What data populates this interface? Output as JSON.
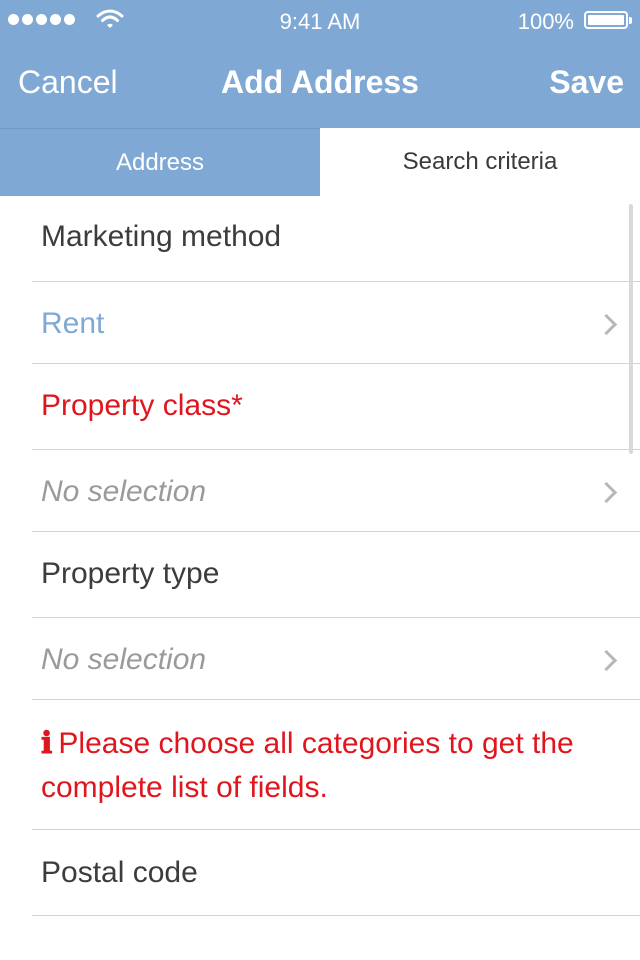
{
  "status_bar": {
    "time": "9:41 AM",
    "battery": "100%"
  },
  "nav": {
    "cancel": "Cancel",
    "title": "Add Address",
    "save": "Save"
  },
  "tabs": [
    {
      "label": "Address",
      "selected": false
    },
    {
      "label": "Search criteria",
      "selected": true
    }
  ],
  "form": {
    "marketing_method": {
      "label": "Marketing method",
      "value": "Rent"
    },
    "property_class": {
      "label": "Property class*",
      "value": "No selection"
    },
    "property_type": {
      "label": "Property type",
      "value": "No selection"
    },
    "info_message": {
      "icon": "ℹ",
      "text": "Please choose all categories to get the complete list of fields."
    },
    "postal_code": {
      "label": "Postal code"
    }
  },
  "colors": {
    "header": "#7fa9d4",
    "required": "#e0161e",
    "value": "#7fa9d4",
    "placeholder": "#9a9a9a"
  }
}
